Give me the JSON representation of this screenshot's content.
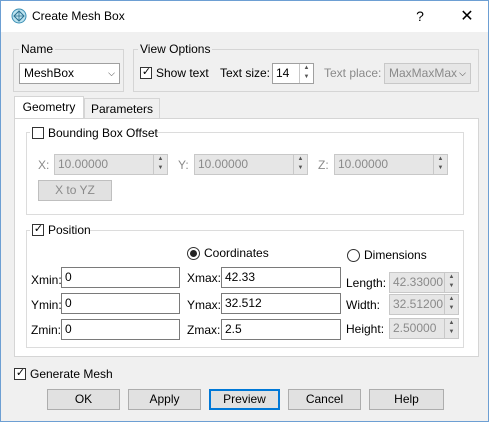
{
  "window": {
    "title": "Create Mesh Box",
    "help_glyph": "?",
    "close_glyph": "✕"
  },
  "name_group": {
    "legend": "Name",
    "value": "MeshBox"
  },
  "view_options": {
    "legend": "View Options",
    "show_text_label": "Show text",
    "show_text_checked": true,
    "text_size_label": "Text size:",
    "text_size_value": "14",
    "text_place_label": "Text place:",
    "text_place_value": "MaxMaxMax"
  },
  "tabs": [
    {
      "label": "Geometry",
      "active": true
    },
    {
      "label": "Parameters",
      "active": false
    }
  ],
  "bbox_offset": {
    "label": "Bounding Box Offset",
    "checked": false,
    "x_label": "X:",
    "x_value": "10.00000",
    "y_label": "Y:",
    "y_value": "10.00000",
    "z_label": "Z:",
    "z_value": "10.00000",
    "x_to_yz_label": "X to YZ"
  },
  "position": {
    "label": "Position",
    "checked": true,
    "coordinates_label": "Coordinates",
    "dimensions_label": "Dimensions",
    "selected_mode": "Coordinates",
    "xmin_label": "Xmin:",
    "xmin_value": "0",
    "ymin_label": "Ymin:",
    "ymin_value": "0",
    "zmin_label": "Zmin:",
    "zmin_value": "0",
    "xmax_label": "Xmax:",
    "xmax_value": "42.33",
    "ymax_label": "Ymax:",
    "ymax_value": "32.512",
    "zmax_label": "Zmax:",
    "zmax_value": "2.5",
    "length_label": "Length:",
    "length_value": "42.33000",
    "width_label": "Width:",
    "width_value": "32.51200",
    "height_label": "Height:",
    "height_value": "2.50000"
  },
  "generate_mesh": {
    "label": "Generate Mesh",
    "checked": true
  },
  "buttons": {
    "ok": "OK",
    "apply": "Apply",
    "preview": "Preview",
    "cancel": "Cancel",
    "help": "Help"
  },
  "colors": {
    "accent": "#0078d7",
    "window_border": "#6d9fd3"
  }
}
